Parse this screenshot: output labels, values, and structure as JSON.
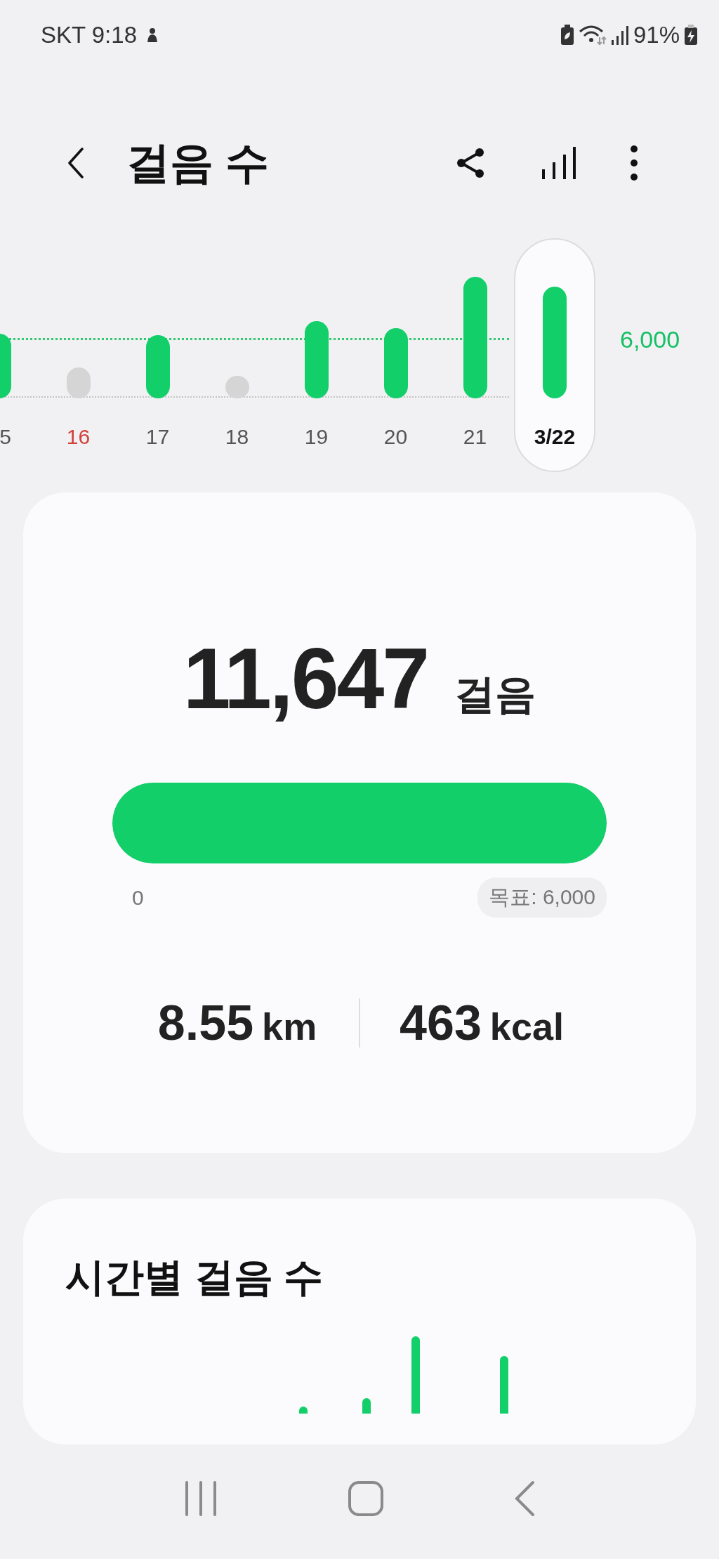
{
  "status_bar": {
    "carrier_time": "SKT 9:18",
    "battery": "91%"
  },
  "header": {
    "title": "걸음 수"
  },
  "daily_chart": {
    "goal_label": "6,000",
    "days": [
      {
        "label": "5",
        "reached": true,
        "sunday": false,
        "selected": false
      },
      {
        "label": "16",
        "reached": false,
        "sunday": true,
        "selected": false
      },
      {
        "label": "17",
        "reached": true,
        "sunday": false,
        "selected": false
      },
      {
        "label": "18",
        "reached": false,
        "sunday": false,
        "selected": false
      },
      {
        "label": "19",
        "reached": true,
        "sunday": false,
        "selected": false
      },
      {
        "label": "20",
        "reached": true,
        "sunday": false,
        "selected": false
      },
      {
        "label": "21",
        "reached": true,
        "sunday": false,
        "selected": false
      },
      {
        "label": "3/22",
        "reached": true,
        "sunday": false,
        "selected": true
      }
    ]
  },
  "summary": {
    "steps": "11,647",
    "steps_unit": "걸음",
    "progress": {
      "level": 1,
      "start_label": "0",
      "goal_label": "목표: 6,000"
    },
    "stats": [
      {
        "value": "8.55",
        "unit": "km"
      },
      {
        "value": "463",
        "unit": "kcal"
      }
    ]
  },
  "hourly": {
    "title": "시간별 걸음 수"
  }
}
